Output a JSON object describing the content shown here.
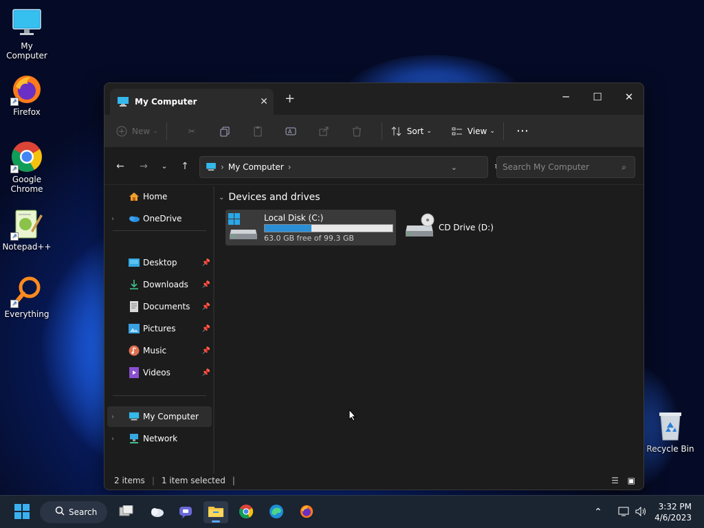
{
  "desktop": {
    "icons": [
      {
        "label": "My Computer"
      },
      {
        "label": "Firefox"
      },
      {
        "label": "Google Chrome"
      },
      {
        "label": "Notepad++"
      },
      {
        "label": "Everything"
      },
      {
        "label": "Recycle Bin"
      }
    ]
  },
  "window": {
    "tab_title": "My Computer",
    "toolbar": {
      "new_label": "New",
      "sort_label": "Sort",
      "view_label": "View"
    },
    "address": {
      "path_item": "My Computer"
    },
    "search": {
      "placeholder": "Search My Computer"
    },
    "nav": {
      "items": [
        {
          "label": "Home",
          "icon": "home-icon"
        },
        {
          "label": "OneDrive",
          "icon": "onedrive-icon"
        },
        {
          "label": "Desktop",
          "icon": "desktop-icon",
          "pinned": true
        },
        {
          "label": "Downloads",
          "icon": "downloads-icon",
          "pinned": true
        },
        {
          "label": "Documents",
          "icon": "documents-icon",
          "pinned": true
        },
        {
          "label": "Pictures",
          "icon": "pictures-icon",
          "pinned": true
        },
        {
          "label": "Music",
          "icon": "music-icon",
          "pinned": true
        },
        {
          "label": "Videos",
          "icon": "videos-icon",
          "pinned": true
        },
        {
          "label": "My Computer",
          "icon": "computer-icon",
          "selected": true
        },
        {
          "label": "Network",
          "icon": "network-icon"
        }
      ]
    },
    "content": {
      "group_title": "Devices and drives",
      "drives": [
        {
          "name": "Local Disk (C:)",
          "free_text": "63.0 GB free of 99.3 GB",
          "used_fraction": 0.366
        },
        {
          "name": "CD Drive (D:)"
        }
      ]
    },
    "status": {
      "items": "2 items",
      "selected": "1 item selected"
    }
  },
  "taskbar": {
    "search_label": "Search",
    "time": "3:32 PM",
    "date": "4/6/2023"
  },
  "colors": {
    "accent": "#2b8fd8",
    "window_bg": "#1c1c1c"
  }
}
